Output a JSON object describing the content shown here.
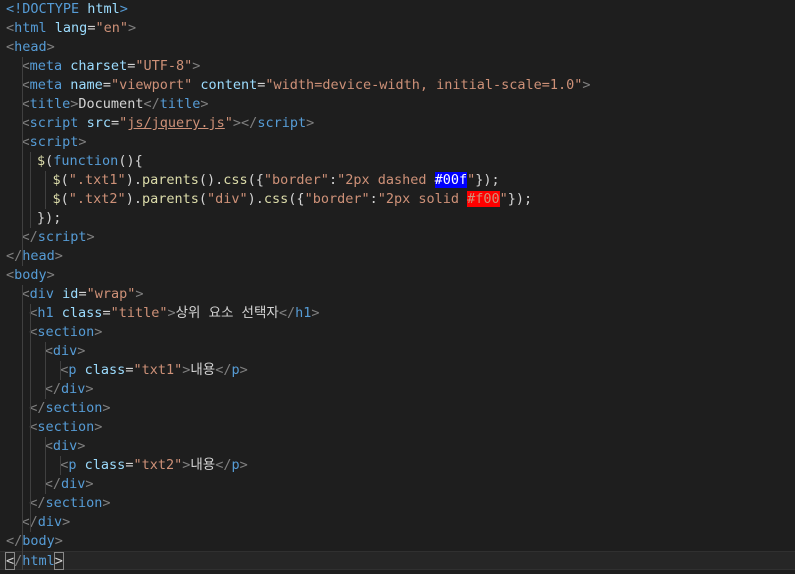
{
  "editor": {
    "lines": [
      {
        "indent": 0,
        "tokens": [
          {
            "t": "<!DOCTYPE ",
            "c": "tag"
          },
          {
            "t": "html",
            "c": "attr"
          },
          {
            "t": ">",
            "c": "tag"
          }
        ]
      },
      {
        "indent": 0,
        "tokens": [
          {
            "t": "<",
            "c": "punc"
          },
          {
            "t": "html",
            "c": "tag"
          },
          {
            "t": " ",
            "c": "text"
          },
          {
            "t": "lang",
            "c": "attr"
          },
          {
            "t": "=",
            "c": "text"
          },
          {
            "t": "\"en\"",
            "c": "str"
          },
          {
            "t": ">",
            "c": "punc"
          }
        ]
      },
      {
        "indent": 0,
        "tokens": [
          {
            "t": "<",
            "c": "punc"
          },
          {
            "t": "head",
            "c": "tag"
          },
          {
            "t": ">",
            "c": "punc"
          }
        ]
      },
      {
        "indent": 1,
        "tokens": [
          {
            "t": "<",
            "c": "punc"
          },
          {
            "t": "meta",
            "c": "tag"
          },
          {
            "t": " ",
            "c": "text"
          },
          {
            "t": "charset",
            "c": "attr"
          },
          {
            "t": "=",
            "c": "text"
          },
          {
            "t": "\"UTF-8\"",
            "c": "str"
          },
          {
            "t": ">",
            "c": "punc"
          }
        ]
      },
      {
        "indent": 1,
        "tokens": [
          {
            "t": "<",
            "c": "punc"
          },
          {
            "t": "meta",
            "c": "tag"
          },
          {
            "t": " ",
            "c": "text"
          },
          {
            "t": "name",
            "c": "attr"
          },
          {
            "t": "=",
            "c": "text"
          },
          {
            "t": "\"viewport\"",
            "c": "str"
          },
          {
            "t": " ",
            "c": "text"
          },
          {
            "t": "content",
            "c": "attr"
          },
          {
            "t": "=",
            "c": "text"
          },
          {
            "t": "\"width=device-width, initial-scale=1.0\"",
            "c": "str"
          },
          {
            "t": ">",
            "c": "punc"
          }
        ]
      },
      {
        "indent": 1,
        "tokens": [
          {
            "t": "<",
            "c": "punc"
          },
          {
            "t": "title",
            "c": "tag"
          },
          {
            "t": ">",
            "c": "punc"
          },
          {
            "t": "Document",
            "c": "text"
          },
          {
            "t": "</",
            "c": "punc"
          },
          {
            "t": "title",
            "c": "tag"
          },
          {
            "t": ">",
            "c": "punc"
          }
        ]
      },
      {
        "indent": 1,
        "tokens": [
          {
            "t": "<",
            "c": "punc"
          },
          {
            "t": "script",
            "c": "tag"
          },
          {
            "t": " ",
            "c": "text"
          },
          {
            "t": "src",
            "c": "attr"
          },
          {
            "t": "=",
            "c": "text"
          },
          {
            "t": "\"",
            "c": "str"
          },
          {
            "t": "js/jquery.js",
            "c": "link"
          },
          {
            "t": "\"",
            "c": "str"
          },
          {
            "t": "></",
            "c": "punc"
          },
          {
            "t": "script",
            "c": "tag"
          },
          {
            "t": ">",
            "c": "punc"
          }
        ]
      },
      {
        "indent": 1,
        "tokens": [
          {
            "t": "<",
            "c": "punc"
          },
          {
            "t": "script",
            "c": "tag"
          },
          {
            "t": ">",
            "c": "punc"
          }
        ]
      },
      {
        "indent": 2,
        "tokens": [
          {
            "t": "$",
            "c": "func"
          },
          {
            "t": "(",
            "c": "op"
          },
          {
            "t": "function",
            "c": "kw"
          },
          {
            "t": "(){",
            "c": "op"
          }
        ]
      },
      {
        "indent": 3,
        "tokens": [
          {
            "t": "$",
            "c": "func"
          },
          {
            "t": "(",
            "c": "op"
          },
          {
            "t": "\".txt1\"",
            "c": "str"
          },
          {
            "t": ").",
            "c": "op"
          },
          {
            "t": "parents",
            "c": "func"
          },
          {
            "t": "().",
            "c": "op"
          },
          {
            "t": "css",
            "c": "func"
          },
          {
            "t": "({",
            "c": "op"
          },
          {
            "t": "\"border\"",
            "c": "str"
          },
          {
            "t": ":",
            "c": "op"
          },
          {
            "t": "\"2px dashed ",
            "c": "str"
          },
          {
            "t": "#00f",
            "c": "hl-blue"
          },
          {
            "t": "\"",
            "c": "str"
          },
          {
            "t": "});",
            "c": "op"
          }
        ]
      },
      {
        "indent": 3,
        "tokens": [
          {
            "t": "$",
            "c": "func"
          },
          {
            "t": "(",
            "c": "op"
          },
          {
            "t": "\".txt2\"",
            "c": "str"
          },
          {
            "t": ").",
            "c": "op"
          },
          {
            "t": "parents",
            "c": "func"
          },
          {
            "t": "(",
            "c": "op"
          },
          {
            "t": "\"div\"",
            "c": "str"
          },
          {
            "t": ").",
            "c": "op"
          },
          {
            "t": "css",
            "c": "func"
          },
          {
            "t": "({",
            "c": "op"
          },
          {
            "t": "\"border\"",
            "c": "str"
          },
          {
            "t": ":",
            "c": "op"
          },
          {
            "t": "\"2px solid ",
            "c": "str"
          },
          {
            "t": "#f00",
            "c": "hl-red"
          },
          {
            "t": "\"",
            "c": "str"
          },
          {
            "t": "});",
            "c": "op"
          }
        ]
      },
      {
        "indent": 2,
        "tokens": [
          {
            "t": "});",
            "c": "op"
          }
        ]
      },
      {
        "indent": 1,
        "tokens": [
          {
            "t": "</",
            "c": "punc"
          },
          {
            "t": "script",
            "c": "tag"
          },
          {
            "t": ">",
            "c": "punc"
          }
        ]
      },
      {
        "indent": 0,
        "tokens": [
          {
            "t": "</",
            "c": "punc"
          },
          {
            "t": "head",
            "c": "tag"
          },
          {
            "t": ">",
            "c": "punc"
          }
        ]
      },
      {
        "indent": 0,
        "tokens": [
          {
            "t": "<",
            "c": "punc"
          },
          {
            "t": "body",
            "c": "tag"
          },
          {
            "t": ">",
            "c": "punc"
          }
        ]
      },
      {
        "indent": 1,
        "tokens": [
          {
            "t": "<",
            "c": "punc"
          },
          {
            "t": "div",
            "c": "tag"
          },
          {
            "t": " ",
            "c": "text"
          },
          {
            "t": "id",
            "c": "attr"
          },
          {
            "t": "=",
            "c": "text"
          },
          {
            "t": "\"wrap\"",
            "c": "str"
          },
          {
            "t": ">",
            "c": "punc"
          }
        ]
      },
      {
        "indent": 1.5,
        "tokens": [
          {
            "t": "<",
            "c": "punc"
          },
          {
            "t": "h1",
            "c": "tag"
          },
          {
            "t": " ",
            "c": "text"
          },
          {
            "t": "class",
            "c": "attr"
          },
          {
            "t": "=",
            "c": "text"
          },
          {
            "t": "\"title\"",
            "c": "str"
          },
          {
            "t": ">",
            "c": "punc"
          },
          {
            "t": "상위 요소 선택자",
            "c": "text"
          },
          {
            "t": "</",
            "c": "punc"
          },
          {
            "t": "h1",
            "c": "tag"
          },
          {
            "t": ">",
            "c": "punc"
          }
        ]
      },
      {
        "indent": 1.5,
        "tokens": [
          {
            "t": "<",
            "c": "punc"
          },
          {
            "t": "section",
            "c": "tag"
          },
          {
            "t": ">",
            "c": "punc"
          }
        ]
      },
      {
        "indent": 2.5,
        "tokens": [
          {
            "t": "<",
            "c": "punc"
          },
          {
            "t": "div",
            "c": "tag"
          },
          {
            "t": ">",
            "c": "punc"
          }
        ]
      },
      {
        "indent": 3.5,
        "tokens": [
          {
            "t": "<",
            "c": "punc"
          },
          {
            "t": "p",
            "c": "tag"
          },
          {
            "t": " ",
            "c": "text"
          },
          {
            "t": "class",
            "c": "attr"
          },
          {
            "t": "=",
            "c": "text"
          },
          {
            "t": "\"txt1\"",
            "c": "str"
          },
          {
            "t": ">",
            "c": "punc"
          },
          {
            "t": "내용",
            "c": "text"
          },
          {
            "t": "</",
            "c": "punc"
          },
          {
            "t": "p",
            "c": "tag"
          },
          {
            "t": ">",
            "c": "punc"
          }
        ]
      },
      {
        "indent": 2.5,
        "tokens": [
          {
            "t": "</",
            "c": "punc"
          },
          {
            "t": "div",
            "c": "tag"
          },
          {
            "t": ">",
            "c": "punc"
          }
        ]
      },
      {
        "indent": 1.5,
        "tokens": [
          {
            "t": "</",
            "c": "punc"
          },
          {
            "t": "section",
            "c": "tag"
          },
          {
            "t": ">",
            "c": "punc"
          }
        ]
      },
      {
        "indent": 1.5,
        "tokens": [
          {
            "t": "<",
            "c": "punc"
          },
          {
            "t": "section",
            "c": "tag"
          },
          {
            "t": ">",
            "c": "punc"
          }
        ]
      },
      {
        "indent": 2.5,
        "tokens": [
          {
            "t": "<",
            "c": "punc"
          },
          {
            "t": "div",
            "c": "tag"
          },
          {
            "t": ">",
            "c": "punc"
          }
        ]
      },
      {
        "indent": 3.5,
        "tokens": [
          {
            "t": "<",
            "c": "punc"
          },
          {
            "t": "p",
            "c": "tag"
          },
          {
            "t": " ",
            "c": "text"
          },
          {
            "t": "class",
            "c": "attr"
          },
          {
            "t": "=",
            "c": "text"
          },
          {
            "t": "\"txt2\"",
            "c": "str"
          },
          {
            "t": ">",
            "c": "punc"
          },
          {
            "t": "내용",
            "c": "text"
          },
          {
            "t": "</",
            "c": "punc"
          },
          {
            "t": "p",
            "c": "tag"
          },
          {
            "t": ">",
            "c": "punc"
          }
        ]
      },
      {
        "indent": 2.5,
        "tokens": [
          {
            "t": "</",
            "c": "punc"
          },
          {
            "t": "div",
            "c": "tag"
          },
          {
            "t": ">",
            "c": "punc"
          }
        ]
      },
      {
        "indent": 1.5,
        "tokens": [
          {
            "t": "</",
            "c": "punc"
          },
          {
            "t": "section",
            "c": "tag"
          },
          {
            "t": ">",
            "c": "punc"
          }
        ]
      },
      {
        "indent": 1,
        "tokens": [
          {
            "t": "</",
            "c": "punc"
          },
          {
            "t": "div",
            "c": "tag"
          },
          {
            "t": ">",
            "c": "punc"
          }
        ]
      },
      {
        "indent": 0,
        "tokens": [
          {
            "t": "</",
            "c": "punc"
          },
          {
            "t": "body",
            "c": "tag"
          },
          {
            "t": ">",
            "c": "punc"
          }
        ]
      },
      {
        "indent": 0,
        "current": true,
        "tokens": [
          {
            "t": "<",
            "c": "bracket-hl"
          },
          {
            "t": "/",
            "c": "punc"
          },
          {
            "t": "html",
            "c": "tag"
          },
          {
            "t": ">",
            "c": "bracket-hl"
          }
        ]
      }
    ]
  },
  "colors": {
    "background": "#1e1e1e",
    "tag": "#569cd6",
    "attribute": "#9cdcfe",
    "string": "#ce9178",
    "function": "#dcdcaa",
    "highlight_blue": "#0000ff",
    "highlight_red": "#ff0000"
  }
}
